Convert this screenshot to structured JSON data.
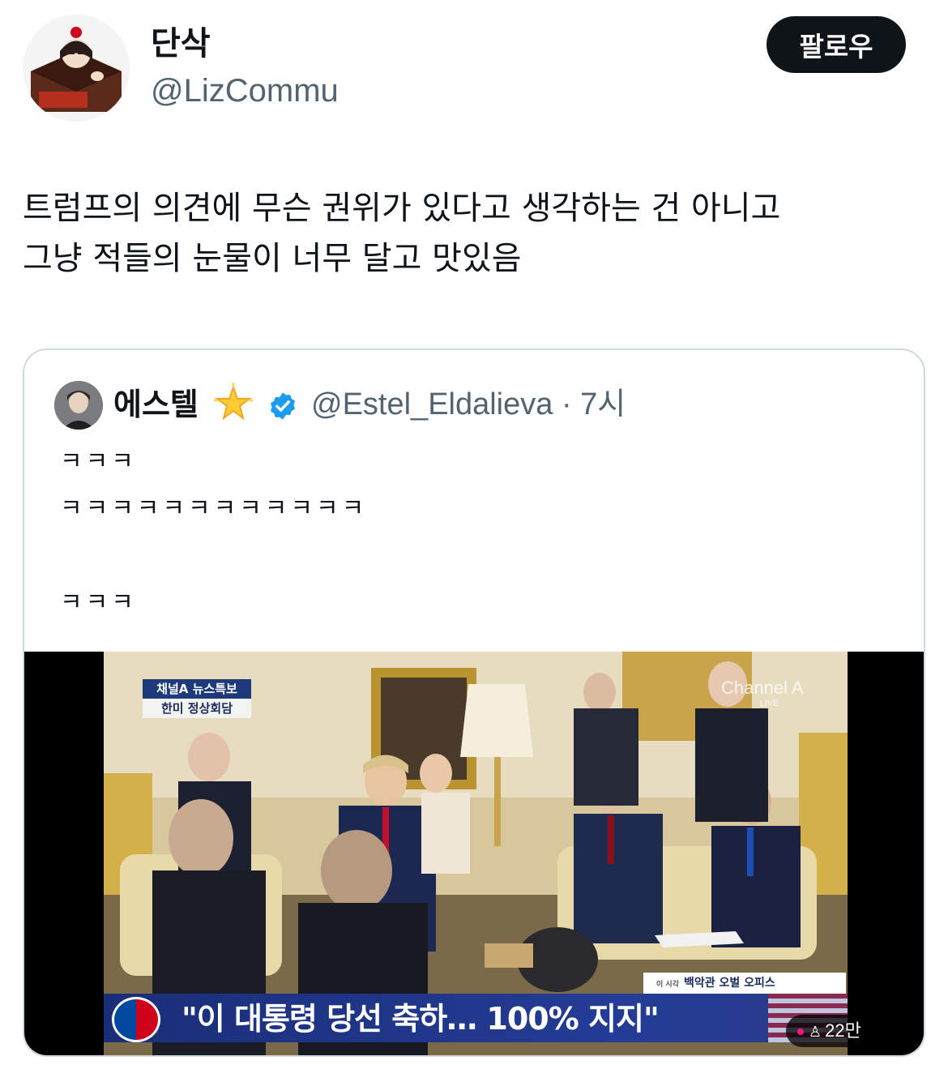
{
  "author": {
    "display_name": "단삭",
    "handle": "@LizCommu",
    "avatar_icon": "avatar-image"
  },
  "follow_label": "팔로우",
  "tweet": {
    "lines": [
      "트럼프의 의견에 무슨 권위가 있다고 생각하는 건 아니고",
      "그냥 적들의 눈물이 너무 달고 맛있음"
    ]
  },
  "quote": {
    "display_name": "에스텔",
    "emoji_icon": "glowing-star-icon",
    "verified_icon": "verified-badge-icon",
    "handle_time": "@Estel_Eldalieva · 7시",
    "lines": [
      "ㅋㅋㅋ",
      "ㅋㅋㅋㅋㅋㅋㅋㅋㅋㅋㅋㅋ",
      "",
      "ㅋㅋㅋ"
    ],
    "media": {
      "tag_top": "채널A 뉴스특보",
      "tag_bottom": "한미 정상회담",
      "watermark": "Channel A",
      "watermark_sub": "LIVE",
      "location_prefix": "이 시각",
      "location": "백악관 오벌 오피스",
      "headline": "\"이 대통령 당선 축하… 100% 지지\"",
      "views": "22만"
    }
  },
  "colors": {
    "text": "#0f1419",
    "secondary": "#536471",
    "verified": "#1d9bf0",
    "border": "#cfd9de"
  }
}
